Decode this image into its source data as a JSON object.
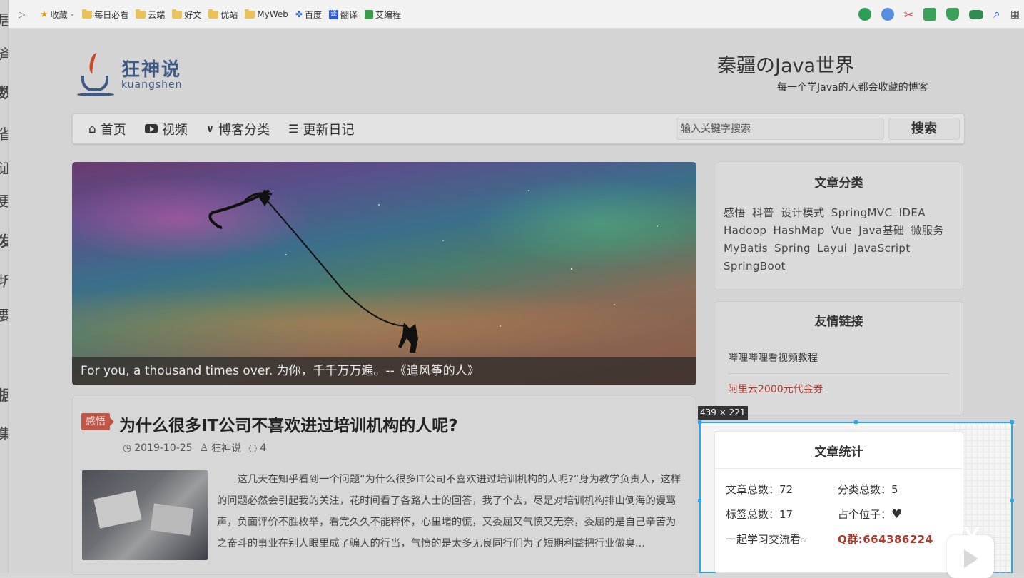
{
  "bookmarks": {
    "items": [
      {
        "label": "收藏",
        "icon": "star-icon"
      },
      {
        "label": "每日必看",
        "icon": "folder-icon"
      },
      {
        "label": "云端",
        "icon": "folder-icon"
      },
      {
        "label": "好文",
        "icon": "folder-icon"
      },
      {
        "label": "优站",
        "icon": "folder-icon"
      },
      {
        "label": "MyWeb",
        "icon": "folder-icon"
      },
      {
        "label": "百度",
        "icon": "baidu-paw-icon"
      },
      {
        "label": "翻译",
        "icon": "translate-icon"
      },
      {
        "label": "艾编程",
        "icon": "code-icon"
      }
    ]
  },
  "left_strip_chars": [
    "居",
    "斉",
    "数",
    "省",
    "证",
    "更",
    "发",
    "圻",
    "要",
    "据",
    "集"
  ],
  "site": {
    "logo_cn": "狂神说",
    "logo_en": "kuangshen",
    "title": "秦疆のJava世界",
    "subtitle": "每一个学Java的人都会收藏的博客"
  },
  "nav": {
    "items": [
      {
        "label": "首页",
        "icon": "home-icon"
      },
      {
        "label": "视频",
        "icon": "youtube-icon"
      },
      {
        "label": "博客分类",
        "icon": "chevron-down-icon"
      },
      {
        "label": "更新日记",
        "icon": "list-icon"
      }
    ],
    "search_placeholder": "输入关键字搜索",
    "search_button": "搜索"
  },
  "banner": {
    "caption": "For you, a thousand times over. 为你，千千万万遍。--《追风筝的人》"
  },
  "article": {
    "tag": "感悟",
    "title": "为什么很多IT公司不喜欢进过培训机构的人呢?",
    "date": "2019-10-25",
    "author": "狂神说",
    "comments": "4",
    "excerpt": "这几天在知乎看到一个问题“为什么很多IT公司不喜欢进过培训机构的人呢?”身为教学负责人，这样的问题必然会引起我的关注，花时间看了各路人士的回答，我了个去，尽是对培训机构排山倒海的谩骂声，负面评价不胜枚举，看完久久不能释怀，心里堵的慌，又委屈又气愤又无奈，委屈的是自己辛苦为之奋斗的事业在别人眼里成了骗人的行当，气愤的是太多无良同行们为了短期利益把行业做臭..."
  },
  "sidebar": {
    "categories_title": "文章分类",
    "categories": [
      "感悟",
      "科普",
      "设计模式",
      "SpringMVC",
      "IDEA",
      "Hadoop",
      "HashMap",
      "Vue",
      "Java基础",
      "微服务",
      "MyBatis",
      "Spring",
      "Layui",
      "JavaScript",
      "SpringBoot"
    ],
    "links_title": "友情链接",
    "links": [
      "哔哩哔哩看视频教程",
      "阿里云2000元代金券"
    ],
    "stats_title": "文章统计",
    "stats": {
      "articles_label": "文章总数：",
      "articles_value": "72",
      "categories_label": "分类总数：",
      "categories_value": "5",
      "tags_label": "标签总数：",
      "tags_value": "17",
      "placeholder_label": "占个位子：",
      "group_label": "一起学习交流看",
      "qq_group": "Q群:664386224"
    }
  },
  "selection": {
    "size_label": "439 × 221"
  },
  "colors": {
    "selection_blue": "#2aa6ef",
    "tag_red": "#c0564a",
    "link_red": "#a83a2f"
  }
}
